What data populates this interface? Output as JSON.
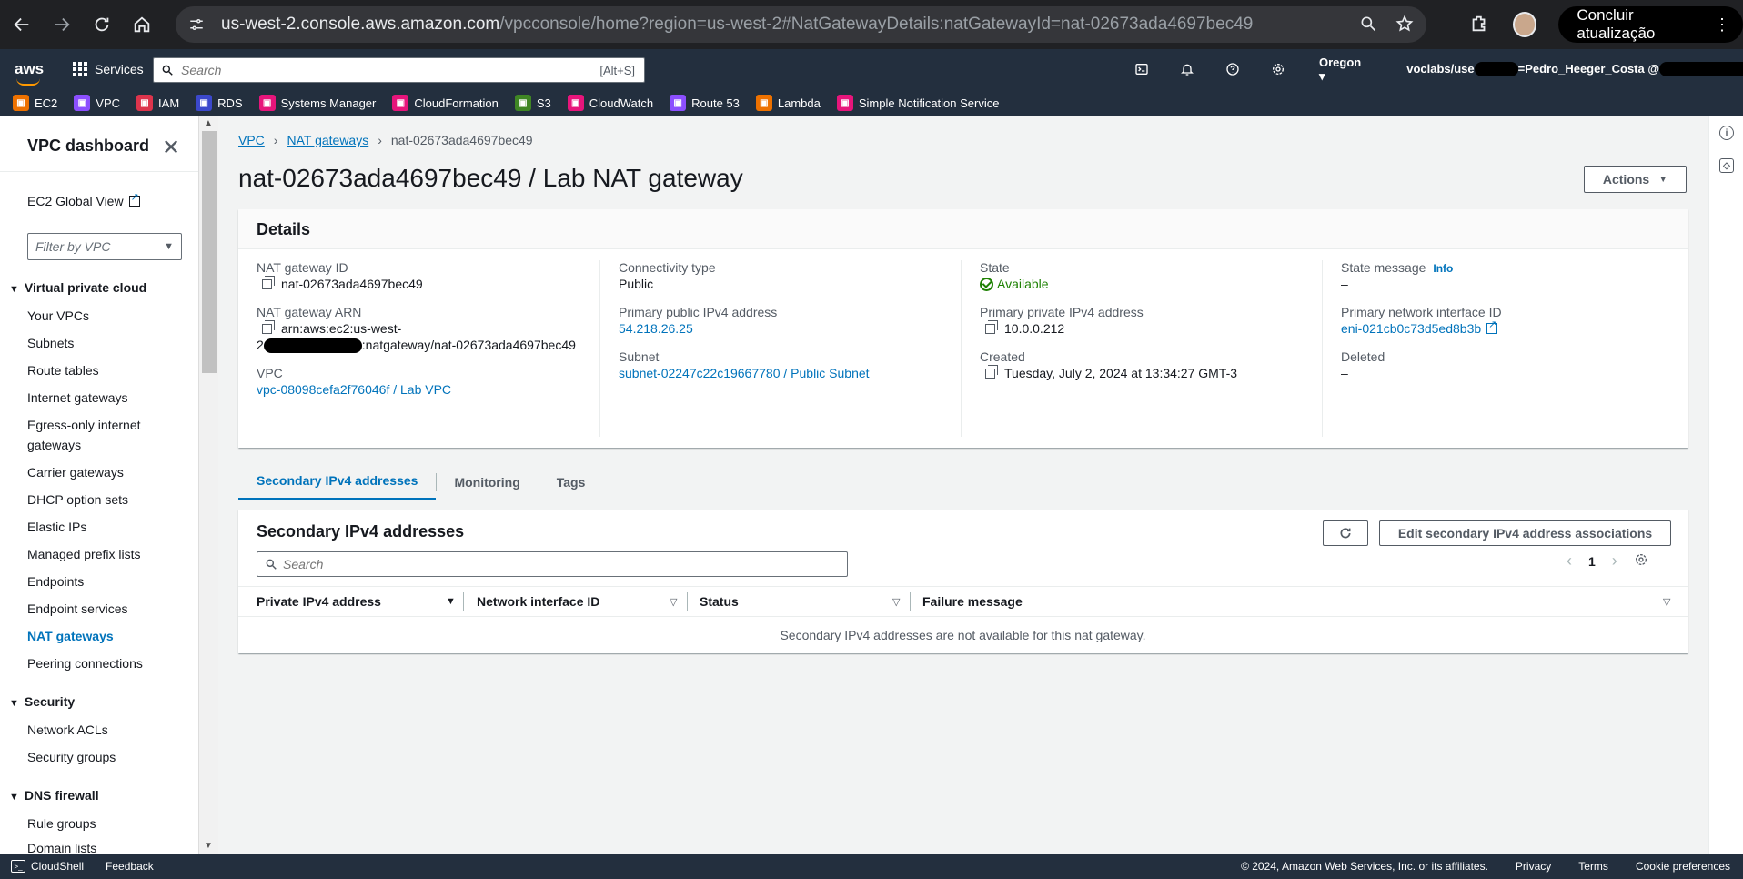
{
  "browser": {
    "url_host": "us-west-2.console.aws.amazon.com",
    "url_rest": "/vpcconsole/home?region=us-west-2#NatGatewayDetails:natGatewayId=nat-02673ada4697bec49",
    "update_label": "Concluir atualização"
  },
  "aws_nav": {
    "logo": "aws",
    "services_label": "Services",
    "search_placeholder": "Search",
    "search_shortcut": "[Alt+S]",
    "region": "Oregon",
    "account_prefix": "voclabs/use",
    "account_suffix": "=Pedro_Heeger_Costa @",
    "favorites": [
      {
        "label": "EC2",
        "color": "#ed7100"
      },
      {
        "label": "VPC",
        "color": "#8c4fff"
      },
      {
        "label": "IAM",
        "color": "#dd344c"
      },
      {
        "label": "RDS",
        "color": "#3b48cc"
      },
      {
        "label": "Systems Manager",
        "color": "#e7157b"
      },
      {
        "label": "CloudFormation",
        "color": "#e7157b"
      },
      {
        "label": "S3",
        "color": "#3f8624"
      },
      {
        "label": "CloudWatch",
        "color": "#e7157b"
      },
      {
        "label": "Route 53",
        "color": "#8c4fff"
      },
      {
        "label": "Lambda",
        "color": "#ed7100"
      },
      {
        "label": "Simple Notification Service",
        "color": "#e7157b"
      }
    ]
  },
  "sidebar": {
    "title": "VPC dashboard",
    "global_view": "EC2 Global View",
    "filter_placeholder": "Filter by VPC",
    "sections": [
      {
        "title": "Virtual private cloud"
      },
      {
        "title": "Security"
      },
      {
        "title": "DNS firewall"
      }
    ],
    "items": [
      "Your VPCs",
      "Subnets",
      "Route tables",
      "Internet gateways",
      "Egress-only internet",
      "gateways",
      "Carrier gateways",
      "DHCP option sets",
      "Elastic IPs",
      "Managed prefix lists",
      "Endpoints",
      "Endpoint services",
      "NAT gateways",
      "Peering connections",
      "Network ACLs",
      "Security groups",
      "Rule groups",
      "Domain lists"
    ]
  },
  "main": {
    "breadcrumb": [
      "VPC",
      "NAT gateways",
      "nat-02673ada4697bec49"
    ],
    "title": "nat-02673ada4697bec49 / Lab NAT gateway",
    "actions_label": "Actions",
    "details": {
      "header": "Details",
      "nat_gateway_id_label": "NAT gateway ID",
      "nat_gateway_id": "nat-02673ada4697bec49",
      "nat_gateway_arn_label": "NAT gateway ARN",
      "nat_gateway_arn_line1": "arn:aws:ec2:us-west-",
      "nat_gateway_arn_line2_prefix": "2",
      "nat_gateway_arn_line2_suffix": ":natgateway/nat-02673ada4697bec49",
      "vpc_label": "VPC",
      "vpc_value": "vpc-08098cefa2f76046f / Lab VPC",
      "connectivity_label": "Connectivity type",
      "connectivity_value": "Public",
      "public_ip_label": "Primary public IPv4 address",
      "public_ip_value": "54.218.26.25",
      "subnet_label": "Subnet",
      "subnet_value": "subnet-02247c22c19667780 / Public Subnet",
      "state_label": "State",
      "state_value": "Available",
      "private_ip_label": "Primary private IPv4 address",
      "private_ip_value": "10.0.0.212",
      "created_label": "Created",
      "created_value": "Tuesday, July 2, 2024 at 13:34:27 GMT-3",
      "state_message_label": "State message",
      "info_label": "Info",
      "state_message_value": "–",
      "eni_label": "Primary network interface ID",
      "eni_value": "eni-021cb0c73d5ed8b3b",
      "deleted_label": "Deleted",
      "deleted_value": "–"
    },
    "tabs": [
      "Secondary IPv4 addresses",
      "Monitoring",
      "Tags"
    ],
    "secondary": {
      "title": "Secondary IPv4 addresses",
      "edit_label": "Edit secondary IPv4 address associations",
      "search_placeholder": "Search",
      "page": "1",
      "columns": [
        "Private IPv4 address",
        "Network interface ID",
        "Status",
        "Failure message"
      ],
      "empty_message": "Secondary IPv4 addresses are not available for this nat gateway."
    }
  },
  "footer": {
    "cloudshell": "CloudShell",
    "feedback": "Feedback",
    "copyright": "© 2024, Amazon Web Services, Inc. or its affiliates.",
    "privacy": "Privacy",
    "terms": "Terms",
    "cookies": "Cookie preferences"
  }
}
